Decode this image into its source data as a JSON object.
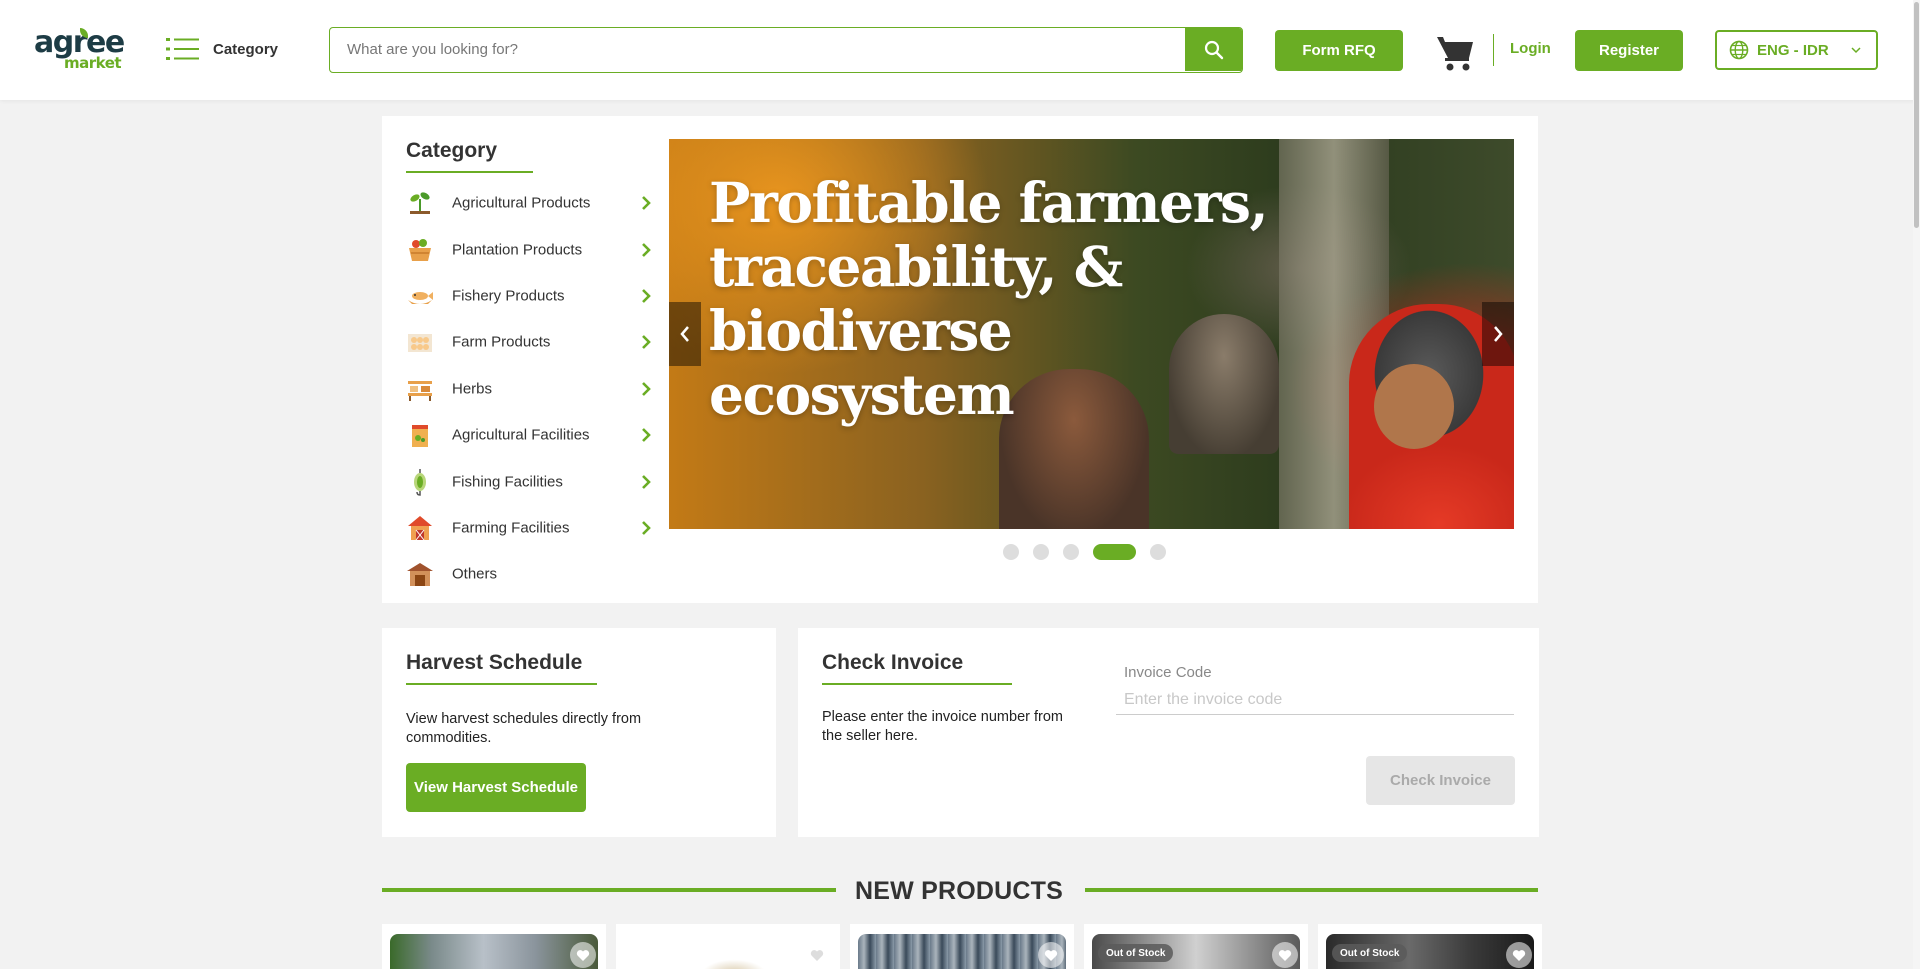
{
  "header": {
    "logo_top": "agree",
    "logo_bottom": "market",
    "category_label": "Category",
    "search_placeholder": "What are you looking for?",
    "rfq_label": "Form RFQ",
    "login_label": "Login",
    "register_label": "Register",
    "language_label": "ENG - IDR"
  },
  "category": {
    "title": "Category",
    "items": [
      {
        "label": "Agricultural Products",
        "icon": "sprout-icon"
      },
      {
        "label": "Plantation Products",
        "icon": "basket-icon"
      },
      {
        "label": "Fishery Products",
        "icon": "fish-icon"
      },
      {
        "label": "Farm Products",
        "icon": "egg-tray-icon"
      },
      {
        "label": "Herbs",
        "icon": "herb-rack-icon"
      },
      {
        "label": "Agricultural Facilities",
        "icon": "seed-bag-icon"
      },
      {
        "label": "Fishing Facilities",
        "icon": "fishing-lure-icon"
      },
      {
        "label": "Farming Facilities",
        "icon": "barn-icon"
      },
      {
        "label": "Others",
        "icon": "shed-icon"
      }
    ]
  },
  "banner": {
    "headline": "Profitable farmers, traceability, & biodiverse ecosystem",
    "slide_count": 5,
    "active_slide": 4
  },
  "harvest": {
    "title": "Harvest Schedule",
    "description": "View harvest schedules directly from commodities.",
    "button_label": "View Harvest Schedule"
  },
  "invoice": {
    "title": "Check Invoice",
    "description": "Please enter the invoice number from the seller here.",
    "field_label": "Invoice Code",
    "field_placeholder": "Enter the invoice code",
    "field_value": "",
    "button_label": "Check Invoice"
  },
  "new_products": {
    "title": "NEW PRODUCTS",
    "products": [
      {
        "badge": "",
        "tone": "fish"
      },
      {
        "badge": "",
        "tone": "light"
      },
      {
        "badge": "",
        "tone": "dried"
      },
      {
        "badge": "Out of Stock",
        "tone": "gray"
      },
      {
        "badge": "Out of Stock",
        "tone": "dark"
      }
    ]
  },
  "colors": {
    "brand_green": "#6aad24",
    "logo_dark": "#1d3c45",
    "disabled_button": "#e6e6e6"
  }
}
